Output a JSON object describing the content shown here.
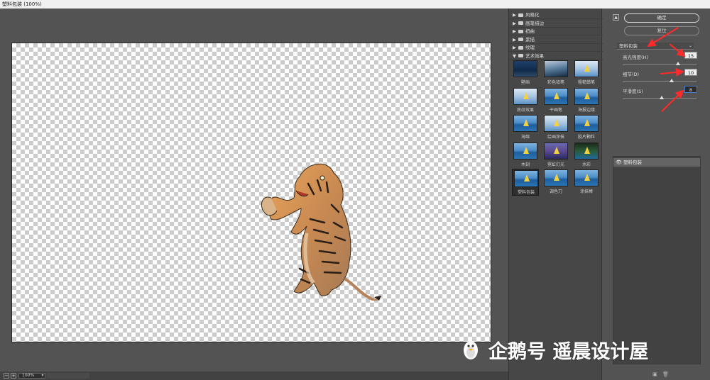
{
  "window": {
    "title": "塑料包装 (100%)"
  },
  "preview": {
    "zoom_minus": "−",
    "zoom_plus": "+",
    "zoom_value": "100%"
  },
  "gallery": {
    "folders": [
      {
        "label": "风格化",
        "expanded": false
      },
      {
        "label": "画笔描边",
        "expanded": false
      },
      {
        "label": "扭曲",
        "expanded": false
      },
      {
        "label": "素描",
        "expanded": false
      },
      {
        "label": "纹理",
        "expanded": false
      },
      {
        "label": "艺术效果",
        "expanded": true
      }
    ],
    "filters": [
      {
        "label": "壁画",
        "style": "dark"
      },
      {
        "label": "彩色铅笔",
        "style": "mtn"
      },
      {
        "label": "粗糙蜡笔",
        "style": "light"
      },
      {
        "label": "底纹效果",
        "style": "light"
      },
      {
        "label": "干画笔",
        "style": "sea"
      },
      {
        "label": "海报边缘",
        "style": "sea"
      },
      {
        "label": "海绵",
        "style": "sea"
      },
      {
        "label": "绘画涂抹",
        "style": "light"
      },
      {
        "label": "胶片颗粒",
        "style": "sea"
      },
      {
        "label": "木刻",
        "style": "sea"
      },
      {
        "label": "霓虹灯光",
        "style": "purple"
      },
      {
        "label": "水彩",
        "style": "green"
      },
      {
        "label": "塑料包装",
        "style": "sea",
        "selected": true
      },
      {
        "label": "调色刀",
        "style": "sea"
      },
      {
        "label": "涂抹棒",
        "style": "sea"
      }
    ]
  },
  "settings": {
    "collapse_glyph": "▲",
    "ok_label": "确定",
    "reset_label": "复位",
    "filter_select": "塑料包装",
    "select_caret": "⌄",
    "params": [
      {
        "label": "高光强度(H)",
        "value": "15",
        "max": 20
      },
      {
        "label": "细节(D)",
        "value": "10",
        "max": 15
      },
      {
        "label": "平滑度(S)",
        "value": "8",
        "max": 15
      }
    ],
    "layer_name": "塑料包装",
    "eye_glyph": "👁",
    "new_layer_glyph": "▣",
    "delete_glyph": "🗑"
  },
  "watermark": {
    "text": "企鹅号 遥晨设计屋"
  }
}
